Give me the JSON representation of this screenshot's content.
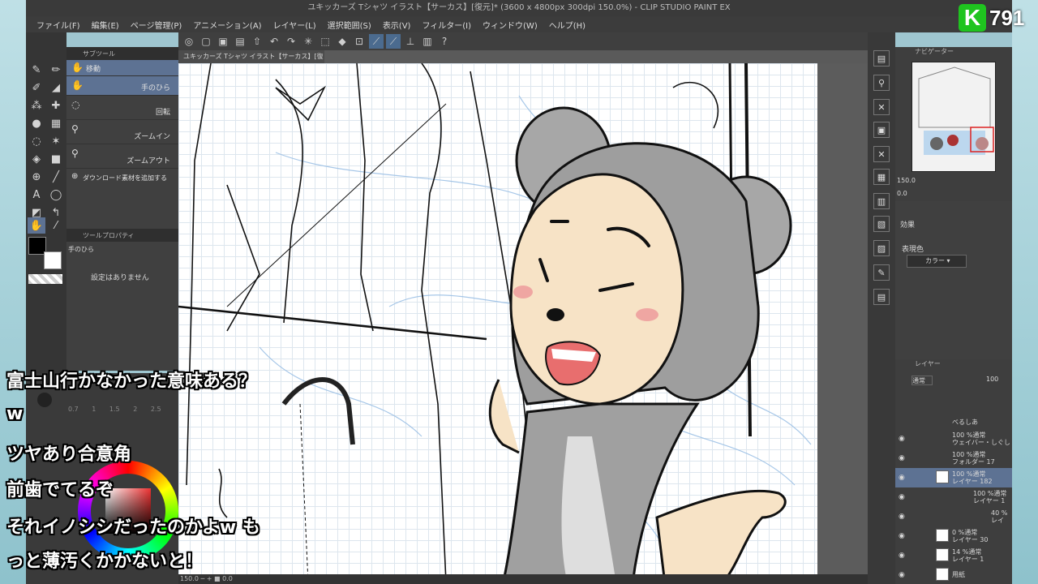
{
  "window": {
    "title": "ユキッカーズ Tシャツ イラスト【サーカス】[復元]* (3600 x 4800px 300dpi 150.0%) - CLIP STUDIO PAINT EX"
  },
  "menu": [
    "ファイル(F)",
    "編集(E)",
    "ページ管理(P)",
    "アニメーション(A)",
    "レイヤー(L)",
    "選択範囲(S)",
    "表示(V)",
    "フィルター(I)",
    "ウィンドウ(W)",
    "ヘルプ(H)"
  ],
  "canvas_tab": "ユキッカーズ Tシャツ イラスト【サーカス】[復元]*",
  "subtool": {
    "header": "サブツール",
    "items": [
      "移動",
      "手のひら",
      "回転",
      "ズームイン",
      "ズームアウト"
    ],
    "add_material": "ダウンロード素材を追加する"
  },
  "tool_property": {
    "header": "ツールプロパティ",
    "tool_name": "手のひら",
    "empty_text": "設定はありません"
  },
  "navigator": {
    "header": "ナビゲーター",
    "zoom": "150.0",
    "rotate": "0.0"
  },
  "color_info": {
    "effect_label": "効果",
    "expression_label": "表現色",
    "expression_value": "カラー"
  },
  "layers": {
    "header": "レイヤー",
    "blend_mode": "通常",
    "opacity": "100",
    "rows": [
      {
        "pct": "",
        "mode": "",
        "name": "べるしあ"
      },
      {
        "pct": "100 %",
        "mode": "通常",
        "name": "ウェイバー・しぐし"
      },
      {
        "pct": "100 %",
        "mode": "通常",
        "name": "フォルダー 17"
      },
      {
        "pct": "100 %",
        "mode": "通常",
        "name": "レイヤー 182"
      },
      {
        "pct": "100 %",
        "mode": "通常",
        "name": "レイヤー 1"
      },
      {
        "pct": "40 %",
        "mode": "通常",
        "name": "レイ"
      },
      {
        "pct": "0 %",
        "mode": "通常",
        "name": "レイヤー 30"
      },
      {
        "pct": "14 %",
        "mode": "通常",
        "name": "レイヤー 1"
      },
      {
        "pct": "",
        "mode": "",
        "name": "用紙"
      }
    ]
  },
  "status": {
    "zoom": "150.0",
    "angle": "0.0"
  },
  "brush_sizes": [
    "0.7",
    "1",
    "1.5",
    "2",
    "2.5"
  ],
  "channel": {
    "logo": "K",
    "count": "791"
  },
  "chat": [
    "富士山行かなかった意味ある？",
    "w",
    "ツヤあり合意角",
    "前歯でてるぞ",
    "それイノシシだったのかよw も",
    "っと薄汚くかかないと！"
  ]
}
